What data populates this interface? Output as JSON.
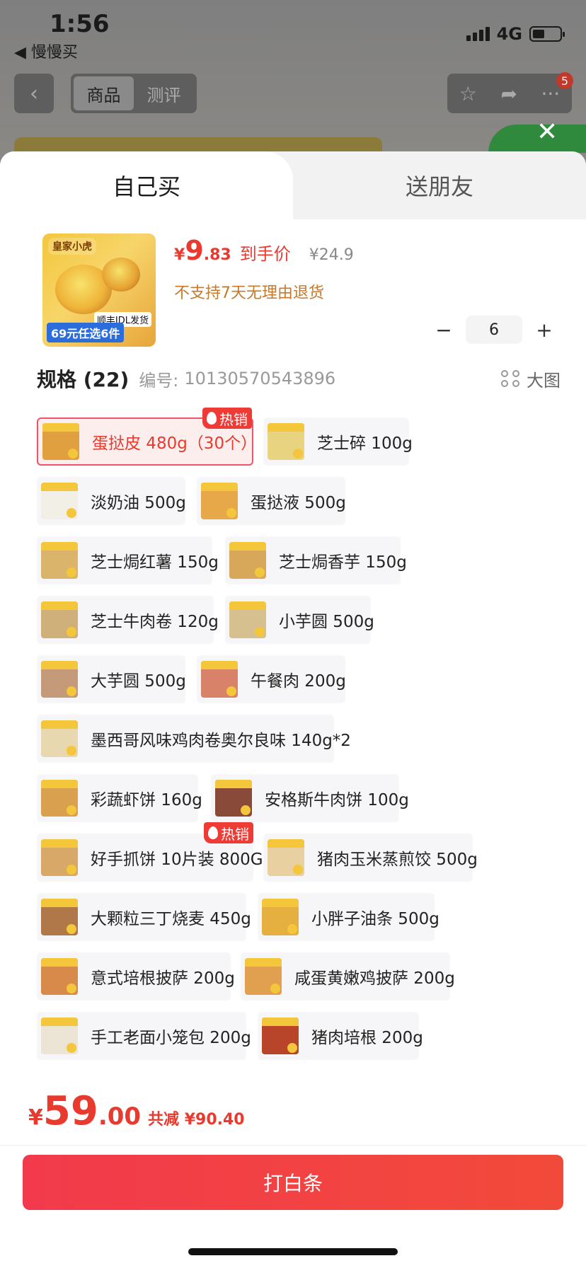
{
  "status": {
    "time": "1:56",
    "back_app": "◀ 慢慢买",
    "network": "4G"
  },
  "top_nav": {
    "tabs": [
      "商品",
      "测评"
    ],
    "badge": "5"
  },
  "sheet": {
    "tabs": {
      "self": "自己买",
      "friend": "送朋友"
    },
    "product": {
      "thumb_brand": "皇家小虎",
      "thumb_tag": "69元任选6件",
      "thumb_sf": "顺丰JDL发货",
      "price_currency": "¥",
      "price_int": "9",
      "price_dec": ".83",
      "price_label": "到手价",
      "original_price": "¥24.9",
      "no_return": "不支持7天无理由退货",
      "quantity": "6",
      "minus": "−",
      "plus": "+"
    },
    "spec": {
      "title": "规格 (22)",
      "code_label": "编号:",
      "code": "10130570543896",
      "big_pic": "大图"
    },
    "hot_label": "热销",
    "specs": [
      {
        "name": "蛋挞皮 480g（30个）"
      },
      {
        "name": "芝士碎 100g"
      },
      {
        "name": "淡奶油 500g"
      },
      {
        "name": "蛋挞液 500g"
      },
      {
        "name": "芝士焗红薯 150g"
      },
      {
        "name": "芝士焗香芋 150g"
      },
      {
        "name": "芝士牛肉卷 120g"
      },
      {
        "name": "小芋圆 500g"
      },
      {
        "name": "大芋圆 500g"
      },
      {
        "name": "午餐肉 200g"
      },
      {
        "name": "墨西哥风味鸡肉卷奥尔良味 140g*2"
      },
      {
        "name": "彩蔬虾饼 160g"
      },
      {
        "name": "安格斯牛肉饼 100g"
      },
      {
        "name": "好手抓饼 10片装 800G"
      },
      {
        "name": "猪肉玉米蒸煎饺 500g"
      },
      {
        "name": "大颗粒三丁烧麦 450g"
      },
      {
        "name": "小胖子油条 500g"
      },
      {
        "name": "意式培根披萨 200g"
      },
      {
        "name": "咸蛋黄嫩鸡披萨 200g"
      },
      {
        "name": "手工老面小笼包 200g"
      },
      {
        "name": "猪肉培根 200g"
      }
    ],
    "total": {
      "currency": "¥",
      "int": "59",
      "dec": ".00",
      "reduce": "共减 ¥90.40"
    },
    "buy_button": "打白条"
  },
  "colors": {
    "accent": "#e83a2e",
    "button": "#f23a4c",
    "note": "#c7782a"
  }
}
